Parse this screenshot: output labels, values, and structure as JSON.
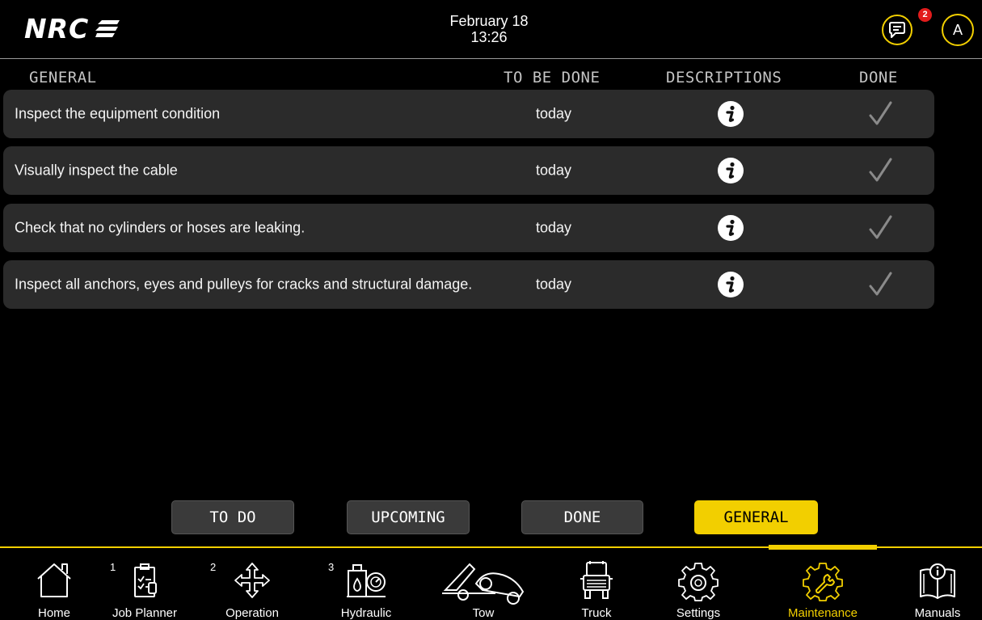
{
  "header": {
    "logo_text": "NRC",
    "date": "February 18",
    "time": "13:26",
    "chat_badge": "2",
    "avatar_initial": "A"
  },
  "columns": {
    "general": "GENERAL",
    "to_be_done": "TO BE DONE",
    "descriptions": "DESCRIPTIONS",
    "done": "DONE"
  },
  "tasks": [
    {
      "label": "Inspect the equipment condition",
      "due": "today"
    },
    {
      "label": "Visually inspect the cable",
      "due": "today"
    },
    {
      "label": "Check that no cylinders or hoses are leaking.",
      "due": "today"
    },
    {
      "label": "Inspect all anchors, eyes and pulleys for cracks and structural damage.",
      "due": "today"
    }
  ],
  "filters": {
    "todo": "TO DO",
    "upcoming": "UPCOMING",
    "done": "DONE",
    "general": "GENERAL",
    "active": "GENERAL"
  },
  "nav": [
    {
      "label": "Home",
      "icon": "home-icon"
    },
    {
      "label": "Job Planner",
      "number": "1",
      "icon": "job-planner-icon"
    },
    {
      "label": "Operation",
      "number": "2",
      "icon": "move-arrows-icon"
    },
    {
      "label": "Hydraulic",
      "number": "3",
      "icon": "hydraulic-icon"
    },
    {
      "label": "Tow",
      "icon": "tow-truck-icon"
    },
    {
      "label": "Truck",
      "icon": "truck-icon"
    },
    {
      "label": "Settings",
      "icon": "gear-icon"
    },
    {
      "label": "Maintenance",
      "icon": "maintenance-gear-wrench-icon",
      "active": true
    },
    {
      "label": "Manuals",
      "icon": "manual-book-icon"
    }
  ],
  "colors": {
    "accent": "#f2cf00",
    "row_bg": "#2b2b2b",
    "badge": "#e21c1c",
    "background": "#000000"
  }
}
